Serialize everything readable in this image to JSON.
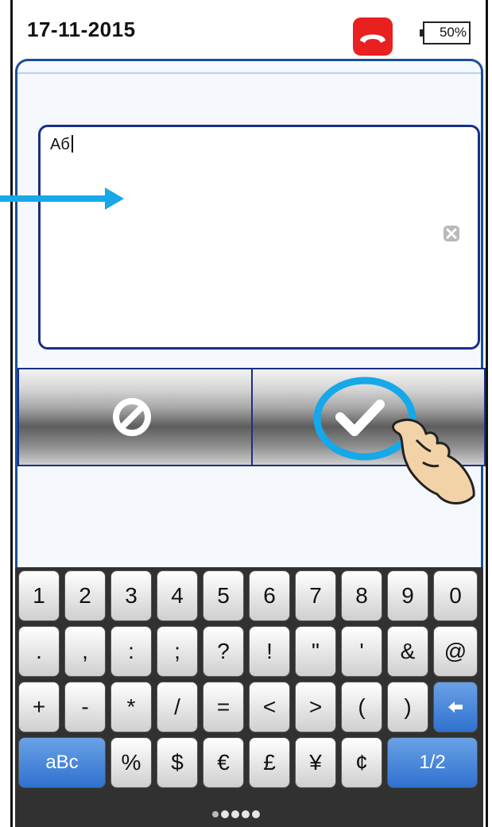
{
  "statusbar": {
    "date": "17-11-2015",
    "battery": "50%"
  },
  "input": {
    "value": "Aб"
  },
  "buttons": {
    "cancel_icon": "forbidden-icon",
    "confirm_icon": "checkmark-icon"
  },
  "keyboard": {
    "row1": [
      "1",
      "2",
      "3",
      "4",
      "5",
      "6",
      "7",
      "8",
      "9",
      "0"
    ],
    "row2": [
      ".",
      ",",
      ":",
      ";",
      "?",
      "!",
      "\"",
      "'",
      "&",
      "@"
    ],
    "row3": [
      "+",
      "-",
      "*",
      "/",
      "=",
      "<",
      ">",
      "(",
      ")"
    ],
    "row4_symbols": [
      "%",
      "$",
      "€",
      "£",
      "¥",
      "¢"
    ],
    "mode_key": "aBc",
    "page_key": "1/2"
  },
  "colors": {
    "accent": "#1a4f9c",
    "call": "#e8201f",
    "highlight": "#16a8e8",
    "key_blue": "#2f72cf"
  }
}
